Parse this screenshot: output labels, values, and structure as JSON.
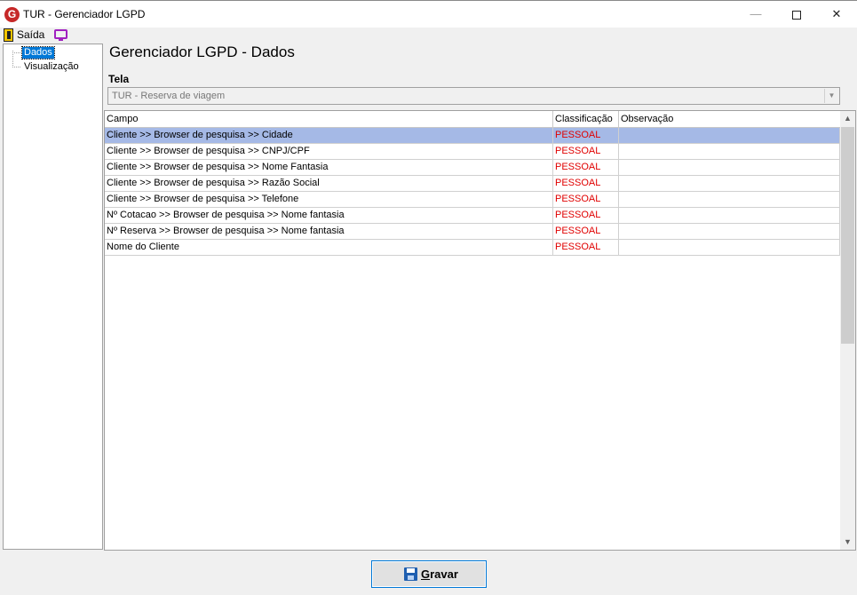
{
  "window": {
    "title": "TUR - Gerenciador LGPD",
    "app_icon_letter": "G"
  },
  "menu": {
    "exit_label": "Saída"
  },
  "tree": {
    "items": [
      {
        "label": "Dados",
        "selected": true
      },
      {
        "label": "Visualização",
        "selected": false
      }
    ]
  },
  "main": {
    "heading": "Gerenciador LGPD - Dados",
    "tela_label": "Tela",
    "tela_value": "TUR - Reserva de viagem"
  },
  "grid": {
    "columns": [
      "Campo",
      "Classificação",
      "Observação"
    ],
    "rows": [
      {
        "campo": "Cliente >> Browser de pesquisa >> Cidade",
        "classificacao": "PESSOAL",
        "observacao": ""
      },
      {
        "campo": "Cliente >> Browser de pesquisa >> CNPJ/CPF",
        "classificacao": "PESSOAL",
        "observacao": ""
      },
      {
        "campo": "Cliente >> Browser de pesquisa >> Nome Fantasia",
        "classificacao": "PESSOAL",
        "observacao": ""
      },
      {
        "campo": "Cliente >> Browser de pesquisa >> Razão Social",
        "classificacao": "PESSOAL",
        "observacao": ""
      },
      {
        "campo": "Cliente >> Browser de pesquisa >> Telefone",
        "classificacao": "PESSOAL",
        "observacao": ""
      },
      {
        "campo": "Nº Cotacao >> Browser de pesquisa >> Nome fantasia",
        "classificacao": "PESSOAL",
        "observacao": ""
      },
      {
        "campo": "Nº Reserva >> Browser de pesquisa >> Nome fantasia",
        "classificacao": "PESSOAL",
        "observacao": ""
      },
      {
        "campo": "Nome do Cliente",
        "classificacao": "PESSOAL",
        "observacao": ""
      }
    ],
    "selected_row": 0
  },
  "footer": {
    "save_label": "Gravar"
  },
  "colors": {
    "selection_row": "#a5b9e6",
    "classification_text": "#e00000",
    "tree_selection": "#0078d7",
    "app_icon": "#c62828"
  }
}
